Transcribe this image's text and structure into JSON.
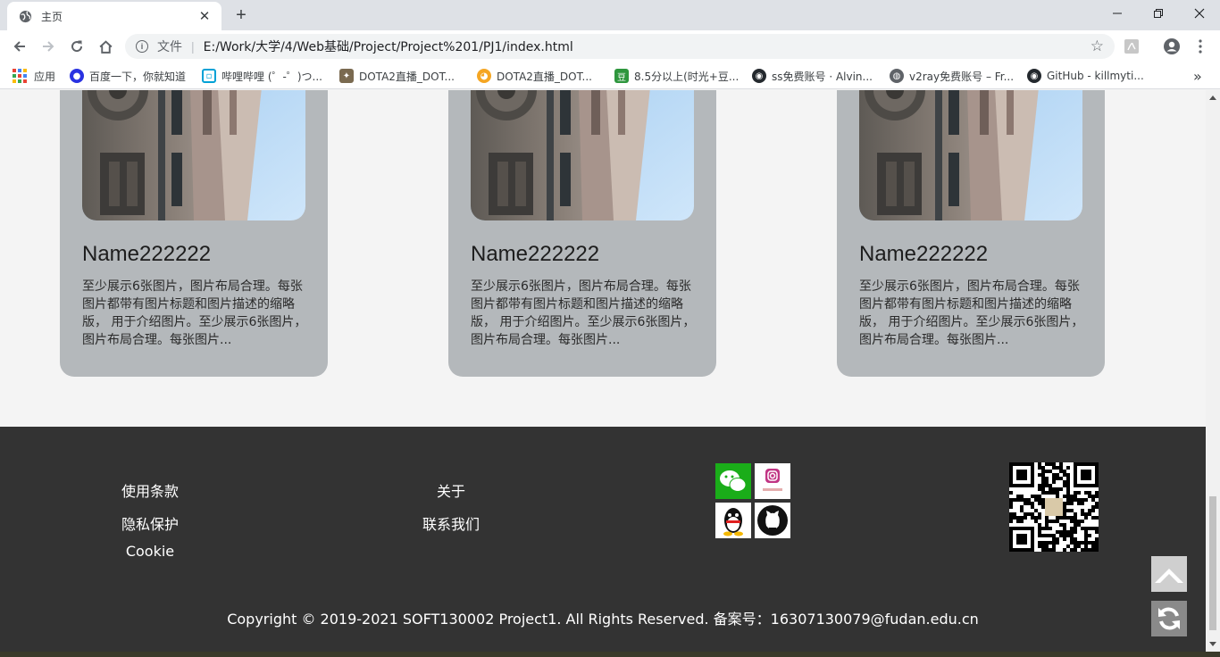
{
  "browser": {
    "tab_title": "主页",
    "new_tab_label": "+",
    "close_tab_label": "✕",
    "url_scheme_label": "文件",
    "url": "E:/Work/大学/4/Web基础/Project/Project%201/PJ1/index.html",
    "window_controls": [
      "minimize-icon",
      "restore-icon",
      "close-icon"
    ]
  },
  "bookmarks": [
    {
      "label": "应用",
      "icon": "apps-grid-icon"
    },
    {
      "label": "百度一下，你就知道",
      "icon": "baidu-icon",
      "color": "#2932e1"
    },
    {
      "label": "哔哩哔哩 (゜-゜)つ...",
      "icon": "bilibili-icon",
      "color": "#00a1d6"
    },
    {
      "label": "DOTA2直播_DOT...",
      "icon": "dota-icon",
      "color": "#7a6a50"
    },
    {
      "label": "DOTA2直播_DOT...",
      "icon": "huya-icon",
      "color": "#f5a623"
    },
    {
      "label": "8.5分以上(时光+豆...",
      "icon": "douban-icon",
      "color": "#2e963d"
    },
    {
      "label": "ss免费账号 · Alvin...",
      "icon": "github-icon",
      "color": "#24292e"
    },
    {
      "label": "v2ray免费账号 – Fr...",
      "icon": "globe-icon",
      "color": "#5f6368"
    },
    {
      "label": "GitHub - killmyti...",
      "icon": "github-icon",
      "color": "#24292e"
    }
  ],
  "bookmarks_overflow": "»",
  "cards": [
    {
      "name": "Name222222",
      "desc": "至少展示6张图片，图片布局合理。每张图片都带有图片标题和图片描述的缩略版， 用于介绍图片。至少展示6张图片，图片布局合理。每张图片..."
    },
    {
      "name": "Name222222",
      "desc": "至少展示6张图片，图片布局合理。每张图片都带有图片标题和图片描述的缩略版， 用于介绍图片。至少展示6张图片，图片布局合理。每张图片..."
    },
    {
      "name": "Name222222",
      "desc": "至少展示6张图片，图片布局合理。每张图片都带有图片标题和图片描述的缩略版， 用于介绍图片。至少展示6张图片，图片布局合理。每张图片..."
    }
  ],
  "footer": {
    "links_col1": [
      "使用条款",
      "隐私保护",
      "Cookie"
    ],
    "links_col2": [
      "关于",
      "联系我们"
    ],
    "social": [
      "wechat-icon",
      "instagram-icon",
      "qq-icon",
      "github-icon"
    ],
    "copyright": "Copyright © 2019-2021 SOFT130002 Project1. All Rights Reserved. 备案号：16307130079@fudan.edu.cn"
  },
  "float_buttons": [
    "back-to-top-icon",
    "refresh-icon"
  ],
  "colors": {
    "card_bg": "#b4b8bb",
    "footer_bg": "#333333",
    "page_bg": "#f4f4f4"
  }
}
